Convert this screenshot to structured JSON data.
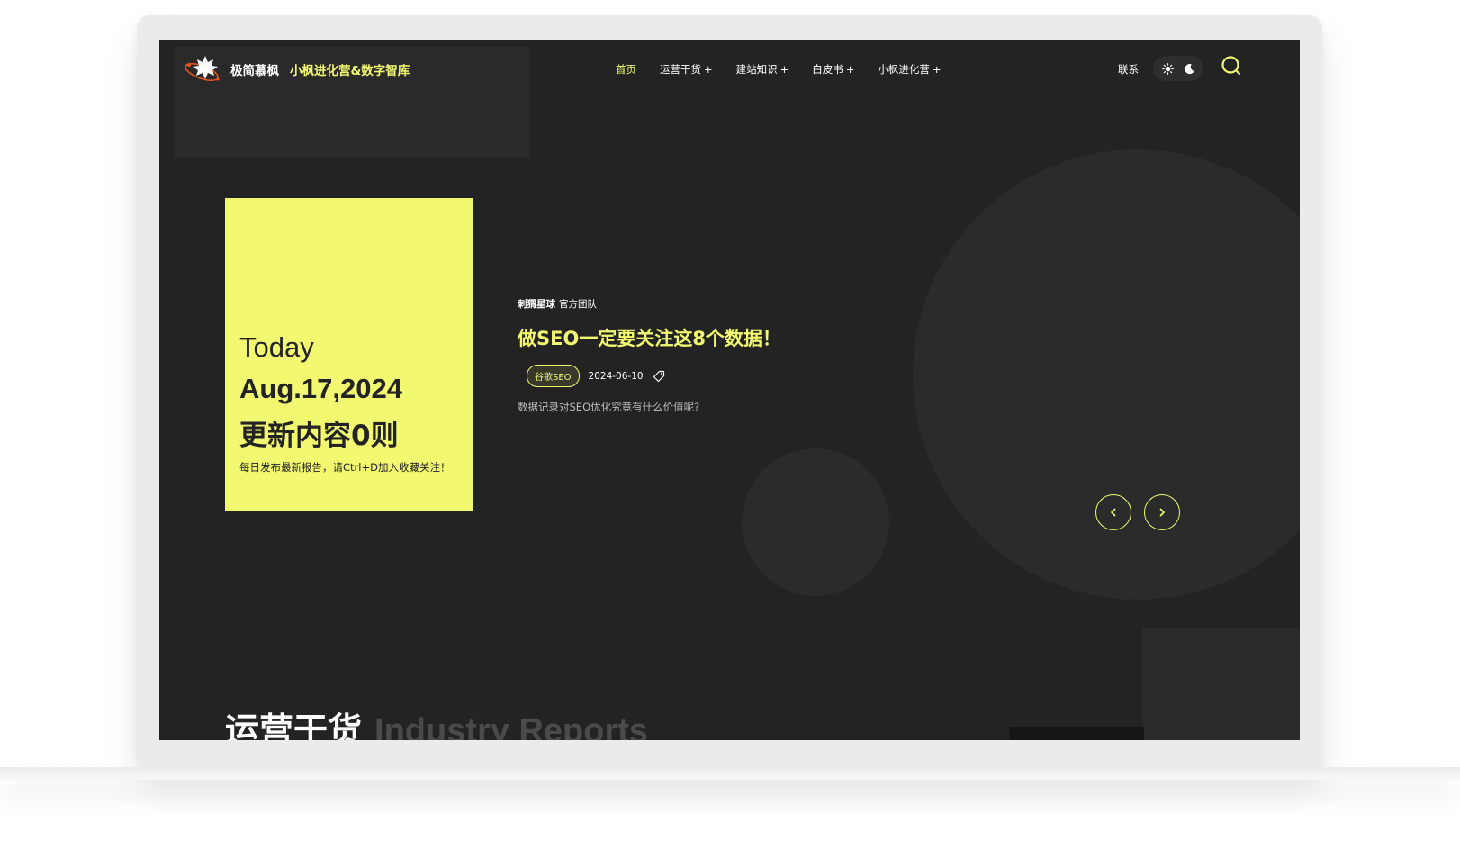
{
  "header": {
    "brand": "极简慕枫",
    "brand_accent": "小枫进化营&数字智库",
    "nav": [
      {
        "label": "首页",
        "active": true,
        "has_submenu": false
      },
      {
        "label": "运营干货",
        "active": false,
        "has_submenu": true
      },
      {
        "label": "建站知识",
        "active": false,
        "has_submenu": true
      },
      {
        "label": "白皮书",
        "active": false,
        "has_submenu": true
      },
      {
        "label": "小枫进化营",
        "active": false,
        "has_submenu": true
      }
    ],
    "submenu_symbol": "+",
    "contact": "联系",
    "theme_icons": [
      "sun-icon",
      "moon-icon"
    ],
    "search_icon": "search-icon"
  },
  "today": {
    "word": "Today",
    "date": "Aug.17,2024",
    "count": "更新内容0则",
    "note": "每日发布最新报告，请Ctrl+D加入收藏关注！"
  },
  "featured": {
    "author": "刺猬星球",
    "team": "官方团队",
    "title": "做SEO一定要关注这8个数据！",
    "tag": "谷歌SEO",
    "date": "2024-06-10",
    "excerpt": "数据记录对SEO优化究竟有什么价值呢?"
  },
  "slider": {
    "prev_icon": "chevron-left-icon",
    "next_icon": "chevron-right-icon"
  },
  "section": {
    "title_zh": "运营干货",
    "title_en": "Industry Reports"
  },
  "colors": {
    "accent": "#f2f971",
    "background": "#232323",
    "shape": "#2b2b2b"
  }
}
